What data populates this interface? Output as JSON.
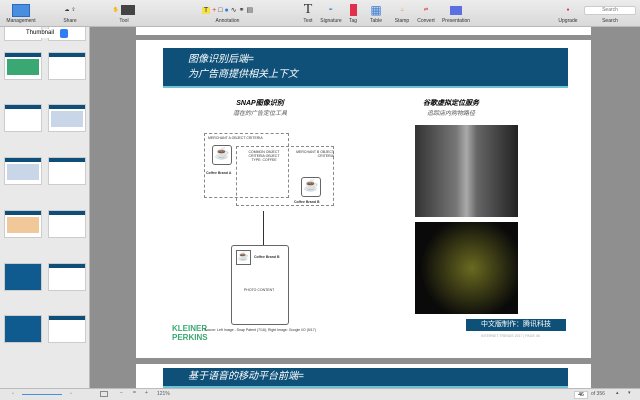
{
  "toolbar": {
    "management": "Management",
    "share": "Share",
    "tool": "Tool",
    "annotation": "Annotation",
    "text": "Text",
    "signature": "Signature",
    "tag": "Tag",
    "table": "Table",
    "stamp": "Stamp",
    "convert": "Convert",
    "presentation": "Presentation",
    "upgrade": "Upgrade",
    "search_label": "Search",
    "search_placeholder": "Search"
  },
  "sidebar": {
    "view_mode": "Thumbnail"
  },
  "slide": {
    "title_line1": "图像识别后端=",
    "title_line2": "为广告商提供相关上下文",
    "left_title": "SNAP图像识别",
    "left_subtitle": "潜在的广告定位工具",
    "right_title": "谷歌虚拟定位服务",
    "right_subtitle": "追踪店内购物路径",
    "diagram": {
      "merchant_a": "MERCHANT A OBJECT CRITERIA",
      "merchant_b": "MERCHANT B OBJECT CRITERIA",
      "common": "COMMON OBJECT CRITERIA OBJECT TYPE: COFFEE",
      "brand_a": "Coffee Brand A",
      "brand_b": "Coffee Brand B",
      "brand_b2": "Coffee Brand B",
      "photo": "PHOTO CONTENT"
    },
    "source": "Source: Left Image - Snap Patent (7/16), Right Image: Google I/O (5/17)",
    "logo_line1": "KLEINER",
    "logo_line2": "PERKINS",
    "badge": "中文版制作：腾讯科技",
    "footer": "INTERNET TRENDS 2017  |  PAGE 46"
  },
  "next_slide": {
    "title": "基于语音的移动平台前端="
  },
  "status": {
    "zoom": "121%",
    "page": "46",
    "of": "of 356"
  }
}
